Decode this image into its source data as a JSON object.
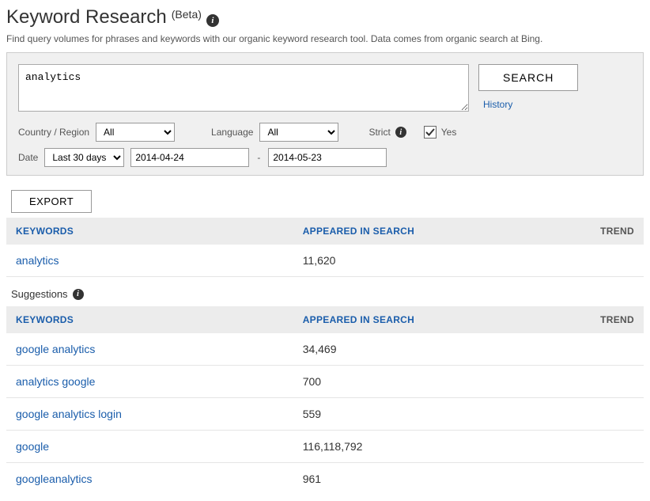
{
  "page": {
    "title": "Keyword Research",
    "beta": "(Beta)",
    "description": "Find query volumes for phrases and keywords with our organic keyword research tool. Data comes from organic search at Bing."
  },
  "search": {
    "query": "analytics",
    "button": "SEARCH",
    "history_link": "History"
  },
  "filters": {
    "country_label": "Country / Region",
    "country_value": "All",
    "language_label": "Language",
    "language_value": "All",
    "strict_label": "Strict",
    "strict_yes": "Yes",
    "date_label": "Date",
    "date_range_value": "Last 30 days",
    "date_from": "2014-04-24",
    "date_to": "2014-05-23"
  },
  "actions": {
    "export": "EXPORT"
  },
  "table": {
    "headers": {
      "keywords": "KEYWORDS",
      "appeared": "APPEARED IN SEARCH",
      "trend": "TREND"
    },
    "primary": [
      {
        "keyword": "analytics",
        "appeared": "11,620"
      }
    ],
    "suggestions_label": "Suggestions",
    "suggestions": [
      {
        "keyword": "google analytics",
        "appeared": "34,469"
      },
      {
        "keyword": "analytics google",
        "appeared": "700"
      },
      {
        "keyword": "google analytics login",
        "appeared": "559"
      },
      {
        "keyword": "google",
        "appeared": "116,118,792"
      },
      {
        "keyword": "googleanalytics",
        "appeared": "961"
      }
    ]
  }
}
